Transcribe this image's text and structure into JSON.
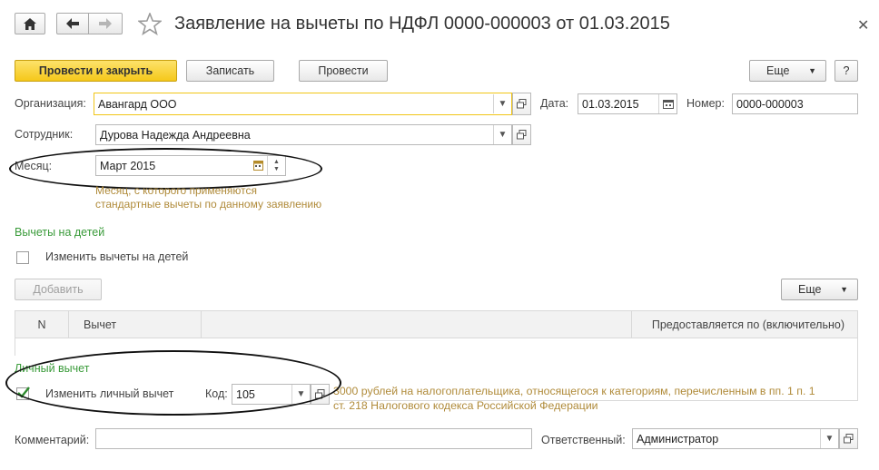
{
  "title": "Заявление на вычеты по НДФЛ 0000-000003 от 01.03.2015",
  "toolbar": {
    "post_close": "Провести и закрыть",
    "save": "Записать",
    "post": "Провести",
    "more": "Еще",
    "help": "?"
  },
  "organization": {
    "label": "Организация:",
    "value": "Авангард ООО"
  },
  "date": {
    "label": "Дата:",
    "value": "01.03.2015"
  },
  "number": {
    "label": "Номер:",
    "value": "0000-000003"
  },
  "employee": {
    "label": "Сотрудник:",
    "value": "Дурова Надежда Андреевна"
  },
  "month": {
    "label": "Месяц:",
    "value": "Март 2015",
    "hint_line1": "Месяц, с которого применяются",
    "hint_line2": "стандартные вычеты по данному заявлению"
  },
  "children": {
    "section_title": "Вычеты на детей",
    "change_label": "Изменить вычеты на детей",
    "add_button": "Добавить",
    "more_button": "Еще",
    "columns": {
      "n": "N",
      "deduction": "Вычет",
      "until": "Предоставляется по (включительно)"
    }
  },
  "personal": {
    "section_title": "Личный вычет",
    "change_label": "Изменить личный вычет",
    "code_label": "Код:",
    "code_value": "105",
    "desc_line1": "3000 рублей на налогоплательщика, относящегося к категориям, перечисленным в пп. 1 п. 1",
    "desc_line2": "ст. 218 Налогового кодекса Российской Федерации"
  },
  "comment": {
    "label": "Комментарий:",
    "value": ""
  },
  "responsible": {
    "label": "Ответственный:",
    "value": "Администратор"
  },
  "colors": {
    "accent_yellow": "#f5c81a",
    "section_green": "#3a9b3a",
    "hint_brown": "#b08b3a"
  }
}
